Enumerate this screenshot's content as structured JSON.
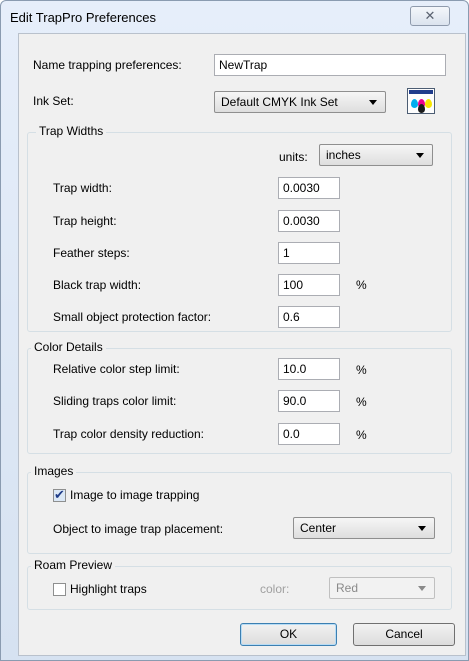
{
  "dialog": {
    "title": "Edit TrapPro Preferences",
    "close_glyph": "✕"
  },
  "name_row": {
    "label": "Name trapping preferences:",
    "value": "NewTrap"
  },
  "ink_set": {
    "label": "Ink Set:",
    "value": "Default CMYK Ink Set",
    "icon": "ink-palette-icon"
  },
  "trap_widths": {
    "title": "Trap Widths",
    "units_label": "units:",
    "units_value": "inches",
    "fields": [
      {
        "label": "Trap width:",
        "value": "0.0030",
        "suffix": ""
      },
      {
        "label": "Trap height:",
        "value": "0.0030",
        "suffix": ""
      },
      {
        "label": "Feather steps:",
        "value": "1",
        "suffix": ""
      },
      {
        "label": "Black trap width:",
        "value": "100",
        "suffix": "%"
      },
      {
        "label": "Small object protection factor:",
        "value": "0.6",
        "suffix": ""
      }
    ]
  },
  "color_details": {
    "title": "Color Details",
    "fields": [
      {
        "label": "Relative color step limit:",
        "value": "10.0",
        "suffix": "%"
      },
      {
        "label": "Sliding traps color limit:",
        "value": "90.0",
        "suffix": "%"
      },
      {
        "label": "Trap color density reduction:",
        "value": "0.0",
        "suffix": "%"
      }
    ]
  },
  "images": {
    "title": "Images",
    "image_to_image": {
      "label": "Image to image trapping",
      "checked": true
    },
    "placement_label": "Object to image trap placement:",
    "placement_value": "Center"
  },
  "roam_preview": {
    "title": "Roam Preview",
    "highlight": {
      "label": "Highlight traps",
      "checked": false
    },
    "color_label": "color:",
    "color_value": "Red"
  },
  "buttons": {
    "ok": "OK",
    "cancel": "Cancel"
  }
}
